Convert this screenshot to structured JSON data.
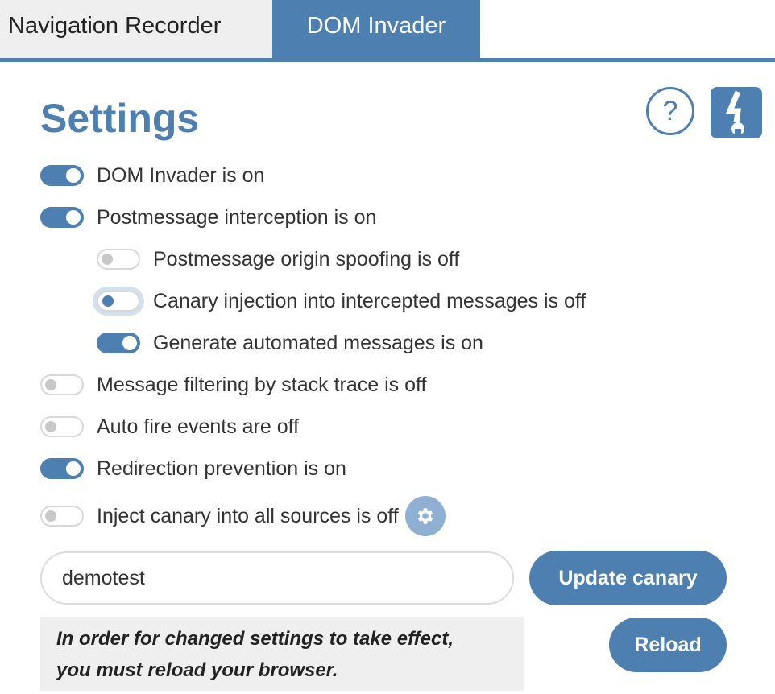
{
  "tabs": [
    {
      "label": "Navigation Recorder",
      "active": false
    },
    {
      "label": "DOM Invader",
      "active": true
    }
  ],
  "header": {
    "title": "Settings",
    "help_icon": "question-circle-icon",
    "help_glyph": "?",
    "logo_icon": "dom-invader-logo-icon"
  },
  "settings": [
    {
      "label": "DOM Invader is on",
      "state": "on",
      "indent": 0
    },
    {
      "label": "Postmessage interception is on",
      "state": "on",
      "indent": 0
    },
    {
      "label": "Postmessage origin spoofing is off",
      "state": "off",
      "indent": 1
    },
    {
      "label": "Canary injection into intercepted messages is off",
      "state": "off-focused",
      "indent": 1
    },
    {
      "label": "Generate automated messages is on",
      "state": "on",
      "indent": 1
    },
    {
      "label": "Message filtering by stack trace is off",
      "state": "off",
      "indent": 0
    },
    {
      "label": "Auto fire events are off",
      "state": "off",
      "indent": 0
    },
    {
      "label": "Redirection prevention is on",
      "state": "on",
      "indent": 0
    },
    {
      "label": "Inject canary into all sources is off",
      "state": "off",
      "indent": 0,
      "has_settings_icon": true
    }
  ],
  "canary": {
    "value": "demotest",
    "update_label": "Update canary"
  },
  "notice": {
    "line1": "In order for changed settings to take effect,",
    "line2": "you must reload your browser."
  },
  "reload_label": "Reload",
  "colors": {
    "accent": "#4e7fb1",
    "accent_light": "#8fb0d2",
    "tab_inactive_bg": "#efefef",
    "notice_bg": "#efefef"
  }
}
